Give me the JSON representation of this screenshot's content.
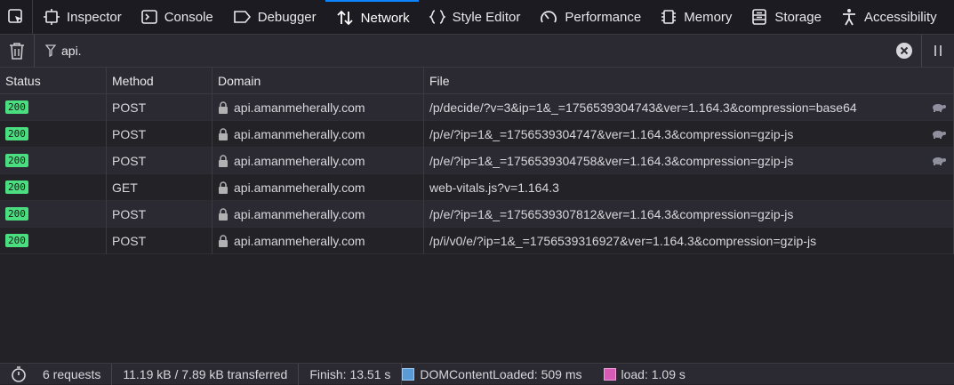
{
  "toolbar": {
    "tabs": [
      {
        "label": "Inspector",
        "icon": "inspector-icon"
      },
      {
        "label": "Console",
        "icon": "console-icon"
      },
      {
        "label": "Debugger",
        "icon": "debugger-icon"
      },
      {
        "label": "Network",
        "icon": "network-icon",
        "active": true
      },
      {
        "label": "Style Editor",
        "icon": "style-editor-icon"
      },
      {
        "label": "Performance",
        "icon": "performance-icon"
      },
      {
        "label": "Memory",
        "icon": "memory-icon"
      },
      {
        "label": "Storage",
        "icon": "storage-icon"
      },
      {
        "label": "Accessibility",
        "icon": "accessibility-icon"
      }
    ]
  },
  "filter": {
    "value": "api."
  },
  "table": {
    "columns": [
      "Status",
      "Method",
      "Domain",
      "File"
    ],
    "rows": [
      {
        "status": "200",
        "method": "POST",
        "domain": "api.amanmeherally.com",
        "file": "/p/decide/?v=3&ip=1&_=1756539304743&ver=1.164.3&compression=base64",
        "throttled": true
      },
      {
        "status": "200",
        "method": "POST",
        "domain": "api.amanmeherally.com",
        "file": "/p/e/?ip=1&_=1756539304747&ver=1.164.3&compression=gzip-js",
        "throttled": true
      },
      {
        "status": "200",
        "method": "POST",
        "domain": "api.amanmeherally.com",
        "file": "/p/e/?ip=1&_=1756539304758&ver=1.164.3&compression=gzip-js",
        "throttled": true
      },
      {
        "status": "200",
        "method": "GET",
        "domain": "api.amanmeherally.com",
        "file": "web-vitals.js?v=1.164.3",
        "throttled": false
      },
      {
        "status": "200",
        "method": "POST",
        "domain": "api.amanmeherally.com",
        "file": "/p/e/?ip=1&_=1756539307812&ver=1.164.3&compression=gzip-js",
        "throttled": false
      },
      {
        "status": "200",
        "method": "POST",
        "domain": "api.amanmeherally.com",
        "file": "/p/i/v0/e/?ip=1&_=1756539316927&ver=1.164.3&compression=gzip-js",
        "throttled": false
      }
    ]
  },
  "statusbar": {
    "requests": "6 requests",
    "transferred": "11.19 kB / 7.89 kB transferred",
    "finish": "Finish: 13.51 s",
    "dom_loaded": "DOMContentLoaded: 509 ms",
    "load": "load: 1.09 s"
  },
  "colors": {
    "accent": "#0a84ff",
    "status_ok": "#4ade80",
    "dom_swatch": "#5b9bd5",
    "load_swatch": "#d65bb5"
  }
}
